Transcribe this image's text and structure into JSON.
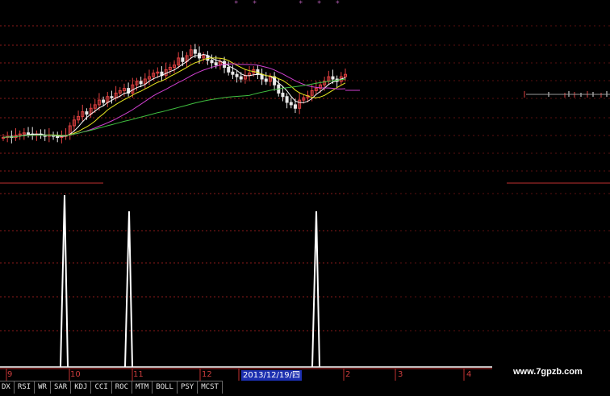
{
  "top_markers": {
    "left": "* *",
    "right": "* * *"
  },
  "date_axis": {
    "labels": [
      "9",
      "10",
      "11",
      "12",
      "2",
      "3",
      "4"
    ],
    "highlight": "2013/12/19/四"
  },
  "indicator_tabs": [
    "DX",
    "RSI",
    "WR",
    "SAR",
    "KDJ",
    "CCI",
    "ROC",
    "MTM",
    "BOLL",
    "PSY",
    "MCST"
  ],
  "watermark": "www.7gpzb.com",
  "colors": {
    "up": "#e04040",
    "down": "#e8e8e8",
    "ma5": "#ffffff",
    "ma10": "#e8e820",
    "ma20": "#d040d0",
    "ma60": "#40c040",
    "signal": "#ffffff",
    "grid": "#8a1a1a"
  },
  "chart_data": [
    {
      "type": "candlestick",
      "title": "",
      "ylim": [
        0,
        100
      ],
      "closes": [
        10,
        11,
        10,
        12,
        13,
        14,
        13,
        12,
        13,
        12,
        11,
        12,
        11,
        10,
        11,
        12,
        20,
        25,
        28,
        32,
        30,
        35,
        38,
        42,
        40,
        45,
        44,
        48,
        50,
        52,
        48,
        55,
        58,
        56,
        60,
        62,
        65,
        66,
        63,
        68,
        70,
        72,
        78,
        75,
        80,
        85,
        82,
        78,
        80,
        76,
        74,
        72,
        75,
        70,
        66,
        64,
        62,
        60,
        63,
        65,
        68,
        64,
        60,
        58,
        62,
        55,
        48,
        45,
        40,
        38,
        35,
        42,
        44,
        46,
        50,
        52,
        55,
        58,
        62,
        60,
        58,
        62,
        64
      ]
    },
    {
      "type": "line",
      "title": "",
      "signal_spikes": [
        80,
        160,
        392
      ],
      "ylim": [
        0,
        1
      ]
    }
  ]
}
